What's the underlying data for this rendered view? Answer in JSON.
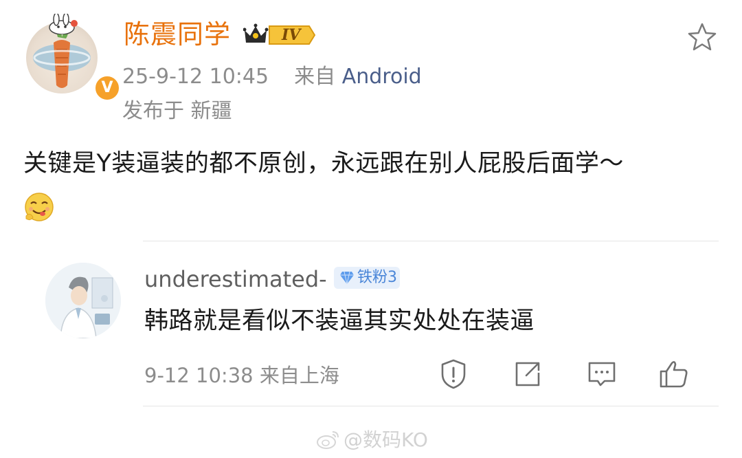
{
  "post": {
    "author": "陈震同学",
    "level_badge": "IV",
    "time": "25-9-12 10:45",
    "source_prefix": "来自",
    "source": "Android",
    "location": "发布于 新疆",
    "text": "关键是Y装逼装的都不原创，永远跟在别人屁股后面学～"
  },
  "reply": {
    "author": "underestimated-",
    "fan_badge": "铁粉3",
    "text": "韩路就是看似不装逼其实处处在装逼",
    "meta": "9-12 10:38  来自上海"
  },
  "watermark": "@数码KO",
  "icons": {
    "favorite": "star-outline-icon",
    "report": "warning-icon",
    "share": "share-icon",
    "comment": "comment-icon",
    "like": "thumbs-up-icon"
  },
  "colors": {
    "author_name": "#e8720c",
    "source_link": "#4a5e8a",
    "meta_gray": "#8c8c8c",
    "fan_badge_bg": "#e8f0fb",
    "fan_badge_text": "#4a86d8",
    "verified_badge": "#f6a12a"
  }
}
